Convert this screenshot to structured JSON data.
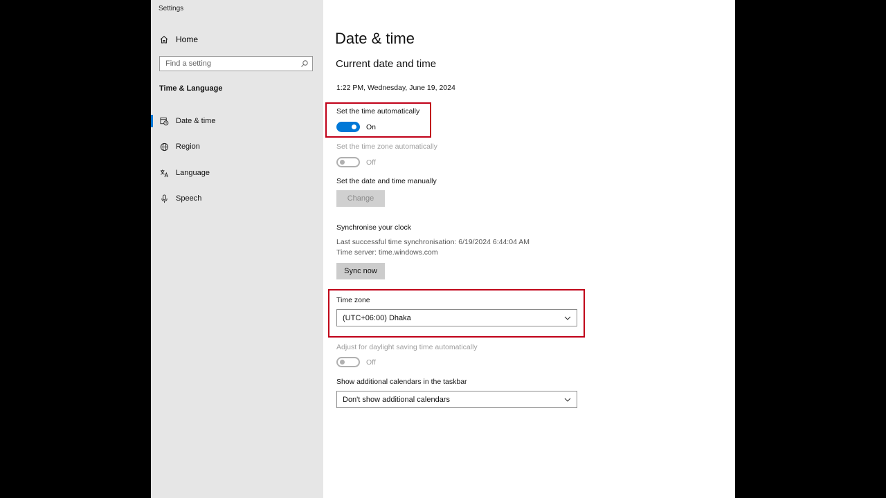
{
  "app": {
    "title": "Settings"
  },
  "sidebar": {
    "home": {
      "label": "Home",
      "icon": "home-icon"
    },
    "search": {
      "placeholder": "Find a setting",
      "icon": "search-icon"
    },
    "section": "Time & Language",
    "items": [
      {
        "label": "Date & time",
        "icon": "clock-calendar-icon",
        "active": true
      },
      {
        "label": "Region",
        "icon": "globe-icon",
        "active": false
      },
      {
        "label": "Language",
        "icon": "language-icon",
        "active": false
      },
      {
        "label": "Speech",
        "icon": "microphone-icon",
        "active": false
      }
    ]
  },
  "main": {
    "title": "Date & time",
    "subtitle": "Current date and time",
    "current_datetime": "1:22 PM, Wednesday, June 19, 2024",
    "auto_time": {
      "label": "Set the time automatically",
      "state": "On",
      "enabled": true
    },
    "auto_timezone": {
      "label": "Set the time zone automatically",
      "state": "Off",
      "enabled": false
    },
    "manual": {
      "label": "Set the date and time manually",
      "button": "Change"
    },
    "sync": {
      "heading": "Synchronise your clock",
      "last_sync": "Last successful time synchronisation: 6/19/2024 6:44:04 AM",
      "server": "Time server: time.windows.com",
      "button": "Sync now"
    },
    "timezone": {
      "label": "Time zone",
      "value": "(UTC+06:00) Dhaka"
    },
    "daylight": {
      "label": "Adjust for daylight saving time automatically",
      "state": "Off",
      "enabled": false
    },
    "calendars": {
      "label": "Show additional calendars in the taskbar",
      "value": "Don't show additional calendars"
    }
  },
  "colors": {
    "accent": "#0078d7",
    "highlight": "#c00018",
    "sidebar_bg": "#e6e6e6"
  }
}
